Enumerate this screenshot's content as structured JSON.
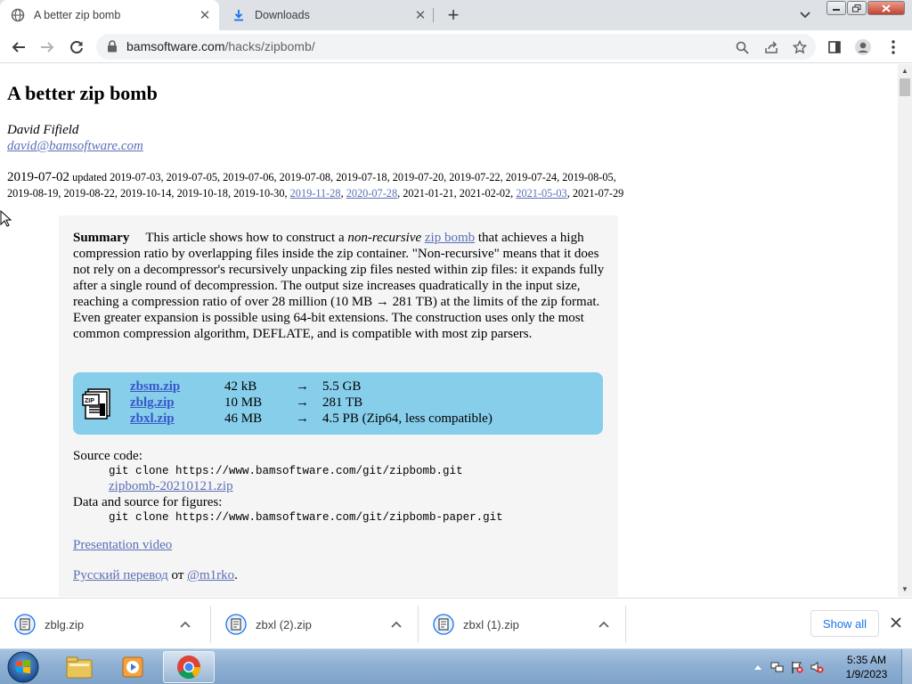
{
  "browser": {
    "tabs": [
      {
        "title": "A better zip bomb",
        "icon": "globe-icon"
      },
      {
        "title": "Downloads",
        "icon": "download-icon"
      }
    ],
    "new_tab_symbol": "+",
    "url_host": "bamsoftware.com",
    "url_path": "/hacks/zipbomb/"
  },
  "page": {
    "title": "A better zip bomb",
    "author": "David Fifield",
    "email": "david@bamsoftware.com",
    "published": "2019-07-02",
    "updated_label": "updated",
    "updated_dates_1": "2019-07-03, 2019-07-05, 2019-07-06, 2019-07-08, 2019-07-18, 2019-07-20, 2019-07-22, 2019-07-24, 2019-08-05,",
    "updated_dates_2": "2019-08-19, 2019-08-22, 2019-10-14, 2019-10-18, 2019-10-30,",
    "updated_link_1": "2019-11-28",
    "updated_link_2": "2020-07-28",
    "updated_dates_3": "2021-01-21, 2021-02-02,",
    "updated_link_3": "2021-05-03",
    "updated_dates_4": "2021-07-29",
    "summary_label": "Summary",
    "summary_p1": "This article shows how to construct a ",
    "summary_em": "non-recursive",
    "summary_link": "zip bomb",
    "summary_p2": " that achieves a high compression ratio by overlapping files inside the zip container. \"Non-recursive\" means that it does not rely on a decompressor's recursively unpacking zip files nested within zip files: it expands fully after a single round of decompression. The output size increases quadratically in the input size, reaching a compression ratio of over 28 million (10 MB → 281 TB) at the limits of the zip format. Even greater expansion is possible using 64-bit extensions. The construction uses only the most common compression algorithm, DEFLATE, and is compatible with most zip parsers.",
    "files": [
      {
        "name": "zbsm.zip",
        "size": "42 kB",
        "arrow": "→",
        "output": "5.5 GB"
      },
      {
        "name": "zblg.zip",
        "size": "10 MB",
        "arrow": "→",
        "output": "281 TB"
      },
      {
        "name": "zbxl.zip",
        "size": "46 MB",
        "arrow": "→",
        "output": "4.5 PB (Zip64, less compatible)"
      }
    ],
    "source_label": "Source code:",
    "source_cmd": "git clone https://www.bamsoftware.com/git/zipbomb.git",
    "source_zip": "zipbomb-20210121.zip",
    "data_label": "Data and source for figures:",
    "data_cmd": "git clone https://www.bamsoftware.com/git/zipbomb-paper.git",
    "video_link": "Presentation video",
    "russian_link": "Русский перевод",
    "russian_by": " от ",
    "russian_author": "@m1rko",
    "russian_end": "."
  },
  "downloads": {
    "items": [
      {
        "name": "zblg.zip"
      },
      {
        "name": "zbxl (2).zip"
      },
      {
        "name": "zbxl (1).zip"
      }
    ],
    "show_all": "Show all"
  },
  "taskbar": {
    "time": "5:35 AM",
    "date": "1/9/2023"
  },
  "colors": {
    "link": "#5b6fb6",
    "file_box": "#87ceeb",
    "summary_bg": "#f5f5f5",
    "tabstrip": "#dee1e6"
  }
}
